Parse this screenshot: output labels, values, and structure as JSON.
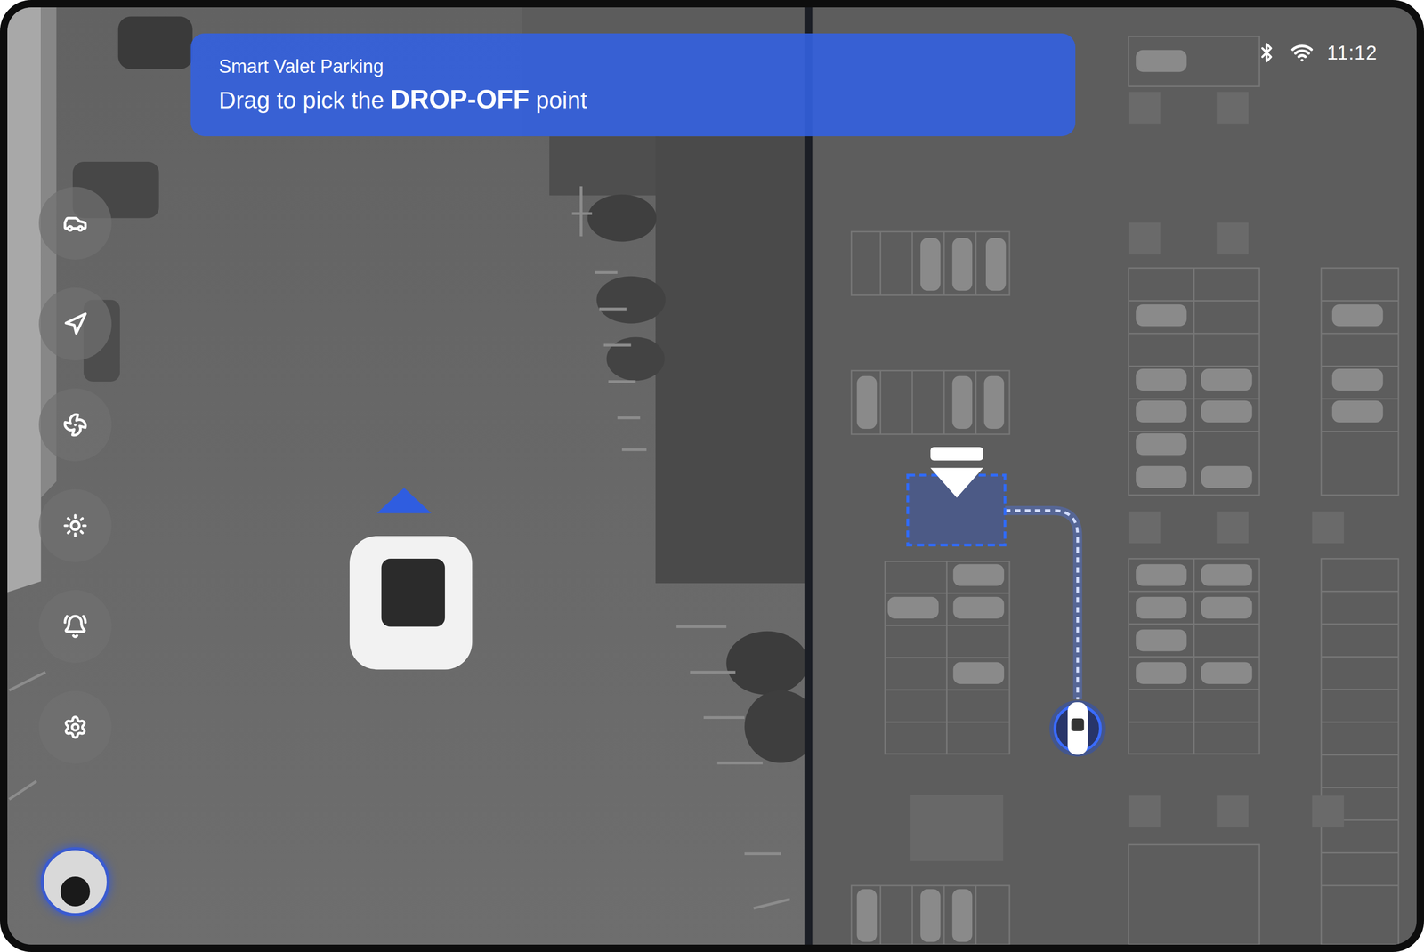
{
  "banner": {
    "subtitle": "Smart Valet Parking",
    "instruction": {
      "before": "Drag to pick the ",
      "emphasis": "DROP-OFF",
      "after": " point"
    }
  },
  "status_bar": {
    "bluetooth": true,
    "wifi": true,
    "time": "11:12"
  }
}
